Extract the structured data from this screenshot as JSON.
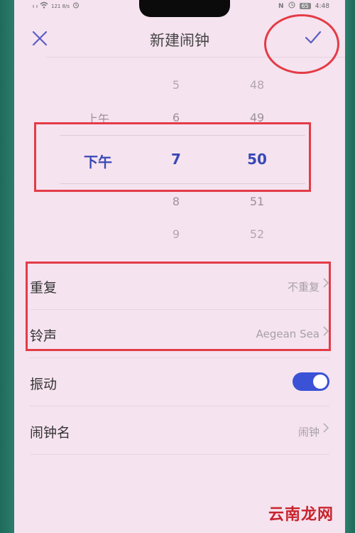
{
  "status_bar": {
    "signal1": "ₗₗ",
    "signal2": "ₗₗ",
    "net": "121 8/s",
    "time": "4:48",
    "battery": "65"
  },
  "header": {
    "title": "新建闹钟",
    "close_icon": "close-icon",
    "confirm_icon": "checkmark-icon"
  },
  "picker": {
    "ampm": {
      "above": "上午",
      "selected": "下午"
    },
    "hour": {
      "above2": "5",
      "above1": "6",
      "selected": "7",
      "below1": "8",
      "below2": "9"
    },
    "minute": {
      "above2": "48",
      "above1": "49",
      "selected": "50",
      "below1": "51",
      "below2": "52"
    }
  },
  "settings": {
    "repeat": {
      "label": "重复",
      "value": "不重复"
    },
    "ringtone": {
      "label": "铃声",
      "value": "Aegean Sea"
    },
    "vibrate": {
      "label": "振动",
      "enabled": true
    },
    "name": {
      "label": "闹钟名",
      "value": "闹钟"
    }
  },
  "watermark": "云南龙网",
  "colors": {
    "accent": "#3a49b5",
    "toggle_on": "#3b52d6",
    "annotation": "#e33c47",
    "background": "#f5e3ef"
  }
}
